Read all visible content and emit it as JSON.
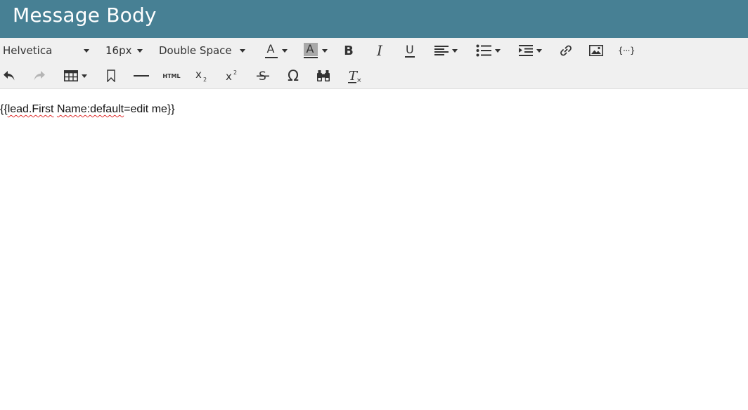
{
  "header": {
    "title": "Message Body"
  },
  "toolbar": {
    "font_family": "Helvetica",
    "font_size": "16px",
    "line_spacing": "Double Space",
    "bold_label": "B",
    "italic_label": "I",
    "underline_label": "U",
    "font_color_label": "A",
    "highlight_label": "A",
    "html_label": "HTML",
    "tokens_label": "{···}",
    "omega_label": "Ω",
    "buttons": [
      "font-color-icon",
      "highlight-color-icon",
      "bold-icon",
      "italic-icon",
      "underline-icon",
      "align-left-icon",
      "bullet-list-icon",
      "indent-icon",
      "link-icon",
      "image-icon",
      "token-icon",
      "undo-icon",
      "redo-icon",
      "table-icon",
      "bookmark-icon",
      "horizontal-rule-icon",
      "html-icon",
      "subscript-icon",
      "superscript-icon",
      "strikethrough-icon",
      "special-char-icon",
      "find-replace-icon",
      "clear-format-icon"
    ]
  },
  "editor": {
    "parts": [
      "{{",
      "lead.First",
      " ",
      "Name:default",
      "=edit me}}"
    ]
  },
  "colors": {
    "header_bg": "#478094",
    "toolbar_bg": "#f0f0f0",
    "spellcheck_underline": "#e03131"
  }
}
